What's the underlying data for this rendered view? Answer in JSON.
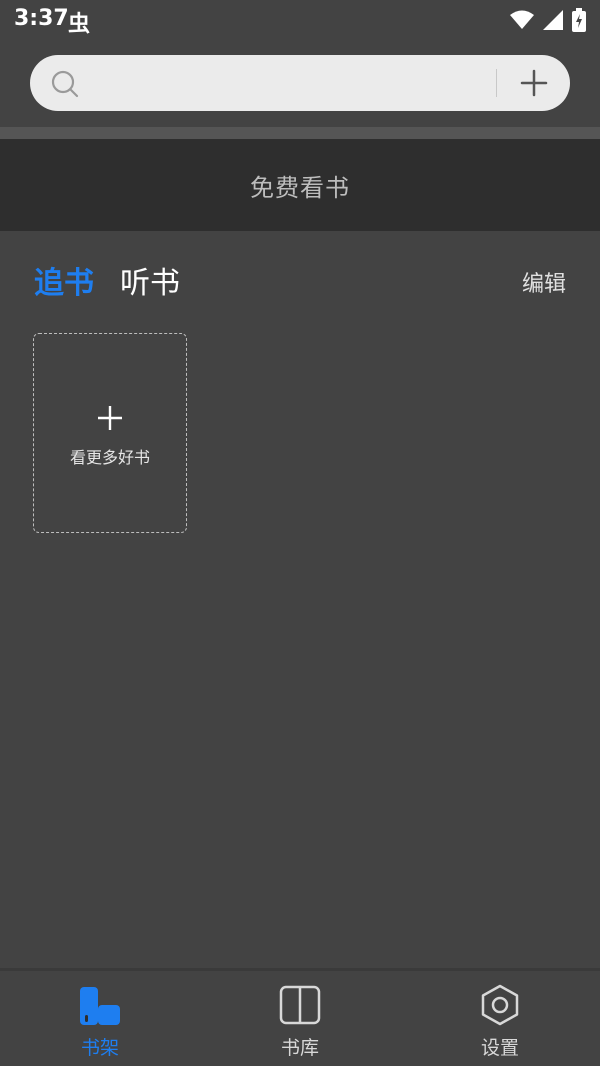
{
  "status_bar": {
    "time": "3:37",
    "app_glyph": "虫"
  },
  "search": {
    "placeholder": "",
    "value": ""
  },
  "promo": {
    "text": "免费看书"
  },
  "tabs": [
    {
      "label": "追书",
      "active": true
    },
    {
      "label": "听书",
      "active": false
    }
  ],
  "edit_label": "编辑",
  "add_card": {
    "label": "看更多好书"
  },
  "bottom_nav": [
    {
      "label": "书架",
      "icon": "bookshelf-icon",
      "active": true
    },
    {
      "label": "书库",
      "icon": "book-library-icon",
      "active": false
    },
    {
      "label": "设置",
      "icon": "settings-gear-icon",
      "active": false
    }
  ],
  "colors": {
    "accent": "#1e7ef0",
    "background": "#434343",
    "banner": "#2e2e2e",
    "search_bg": "#ebebeb"
  }
}
